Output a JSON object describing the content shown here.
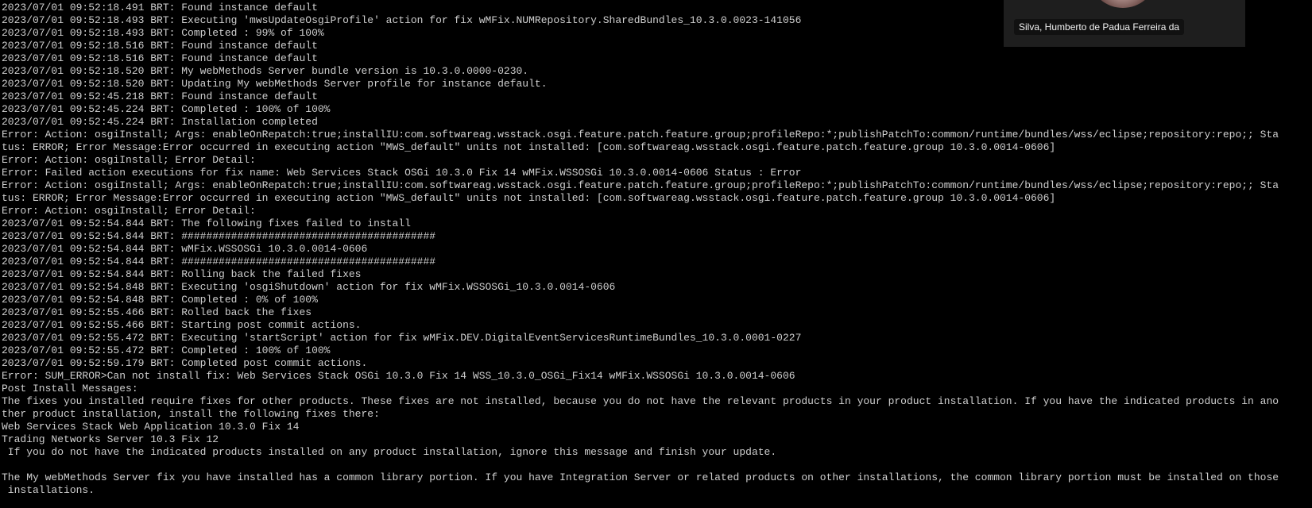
{
  "terminal": {
    "lines": [
      "2023/07/01 09:52:18.491 BRT: Found instance default",
      "2023/07/01 09:52:18.493 BRT: Executing 'mwsUpdateOsgiProfile' action for fix wMFix.NUMRepository.SharedBundles_10.3.0.0023-141056",
      "2023/07/01 09:52:18.493 BRT: Completed : 99% of 100%",
      "2023/07/01 09:52:18.516 BRT: Found instance default",
      "2023/07/01 09:52:18.516 BRT: Found instance default",
      "2023/07/01 09:52:18.520 BRT: My webMethods Server bundle version is 10.3.0.0000-0230.",
      "2023/07/01 09:52:18.520 BRT: Updating My webMethods Server profile for instance default.",
      "2023/07/01 09:52:45.218 BRT: Found instance default",
      "2023/07/01 09:52:45.224 BRT: Completed : 100% of 100%",
      "2023/07/01 09:52:45.224 BRT: Installation completed",
      "Error: Action: osgiInstall; Args: enableOnRepatch:true;installIU:com.softwareag.wsstack.osgi.feature.patch.feature.group;profileRepo:*;publishPatchTo:common/runtime/bundles/wss/eclipse;repository:repo;; Sta",
      "tus: ERROR; Error Message:Error occurred in executing action \"MWS_default\" units not installed: [com.softwareag.wsstack.osgi.feature.patch.feature.group 10.3.0.0014-0606]",
      "Error: Action: osgiInstall; Error Detail:",
      "Error: Failed action executions for fix name: Web Services Stack OSGi 10.3.0 Fix 14 wMFix.WSSOSGi 10.3.0.0014-0606 Status : Error",
      "Error: Action: osgiInstall; Args: enableOnRepatch:true;installIU:com.softwareag.wsstack.osgi.feature.patch.feature.group;profileRepo:*;publishPatchTo:common/runtime/bundles/wss/eclipse;repository:repo;; Sta",
      "tus: ERROR; Error Message:Error occurred in executing action \"MWS_default\" units not installed: [com.softwareag.wsstack.osgi.feature.patch.feature.group 10.3.0.0014-0606]",
      "Error: Action: osgiInstall; Error Detail:",
      "2023/07/01 09:52:54.844 BRT: The following fixes failed to install",
      "2023/07/01 09:52:54.844 BRT: #########################################",
      "2023/07/01 09:52:54.844 BRT: wMFix.WSSOSGi 10.3.0.0014-0606",
      "2023/07/01 09:52:54.844 BRT: #########################################",
      "2023/07/01 09:52:54.844 BRT: Rolling back the failed fixes",
      "2023/07/01 09:52:54.848 BRT: Executing 'osgiShutdown' action for fix wMFix.WSSOSGi_10.3.0.0014-0606",
      "2023/07/01 09:52:54.848 BRT: Completed : 0% of 100%",
      "2023/07/01 09:52:55.466 BRT: Rolled back the fixes",
      "2023/07/01 09:52:55.466 BRT: Starting post commit actions.",
      "2023/07/01 09:52:55.472 BRT: Executing 'startScript' action for fix wMFix.DEV.DigitalEventServicesRuntimeBundles_10.3.0.0001-0227",
      "2023/07/01 09:52:55.472 BRT: Completed : 100% of 100%",
      "2023/07/01 09:52:59.179 BRT: Completed post commit actions.",
      "Error: SUM_ERROR>Can not install fix: Web Services Stack OSGi 10.3.0 Fix 14 WSS_10.3.0_OSGi_Fix14 wMFix.WSSOSGi 10.3.0.0014-0606",
      "Post Install Messages:",
      "The fixes you installed require fixes for other products. These fixes are not installed, because you do not have the relevant products in your product installation. If you have the indicated products in ano",
      "ther product installation, install the following fixes there:",
      "Web Services Stack Web Application 10.3.0 Fix 14",
      "Trading Networks Server 10.3 Fix 12",
      " If you do not have the indicated products installed on any product installation, ignore this message and finish your update.",
      "",
      "The My webMethods Server fix you have installed has a common library portion. If you have Integration Server or related products on other installations, the common library portion must be installed on those",
      " installations."
    ]
  },
  "video_tile": {
    "participant_name": "Silva, Humberto de Padua Ferreira da"
  }
}
